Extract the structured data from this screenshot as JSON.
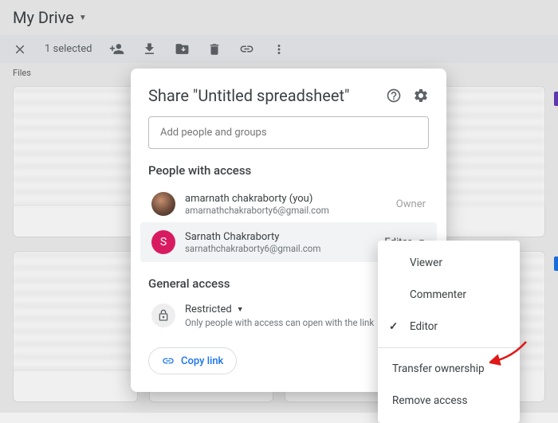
{
  "header": {
    "title": "My Drive"
  },
  "action_bar": {
    "selected": "1 selected"
  },
  "files_label": "Files",
  "dialog": {
    "title": "Share \"Untitled spreadsheet\"",
    "input_placeholder": "Add people and groups",
    "people_label": "People with access",
    "people": [
      {
        "name": "amarnath chakraborty (you)",
        "email": "amarnathchakraborty6@gmail.com",
        "role": "Owner",
        "avatar_letter": ""
      },
      {
        "name": "Sarnath Chakraborty",
        "email": "sarnathchakraborty6@gmail.com",
        "role": "Editor",
        "avatar_letter": "S"
      }
    ],
    "general_label": "General access",
    "restricted_title": "Restricted",
    "restricted_sub": "Only people with access can open with the link",
    "copy_link": "Copy link"
  },
  "role_menu": {
    "viewer": "Viewer",
    "commenter": "Commenter",
    "editor": "Editor",
    "transfer": "Transfer ownership",
    "remove": "Remove access"
  }
}
